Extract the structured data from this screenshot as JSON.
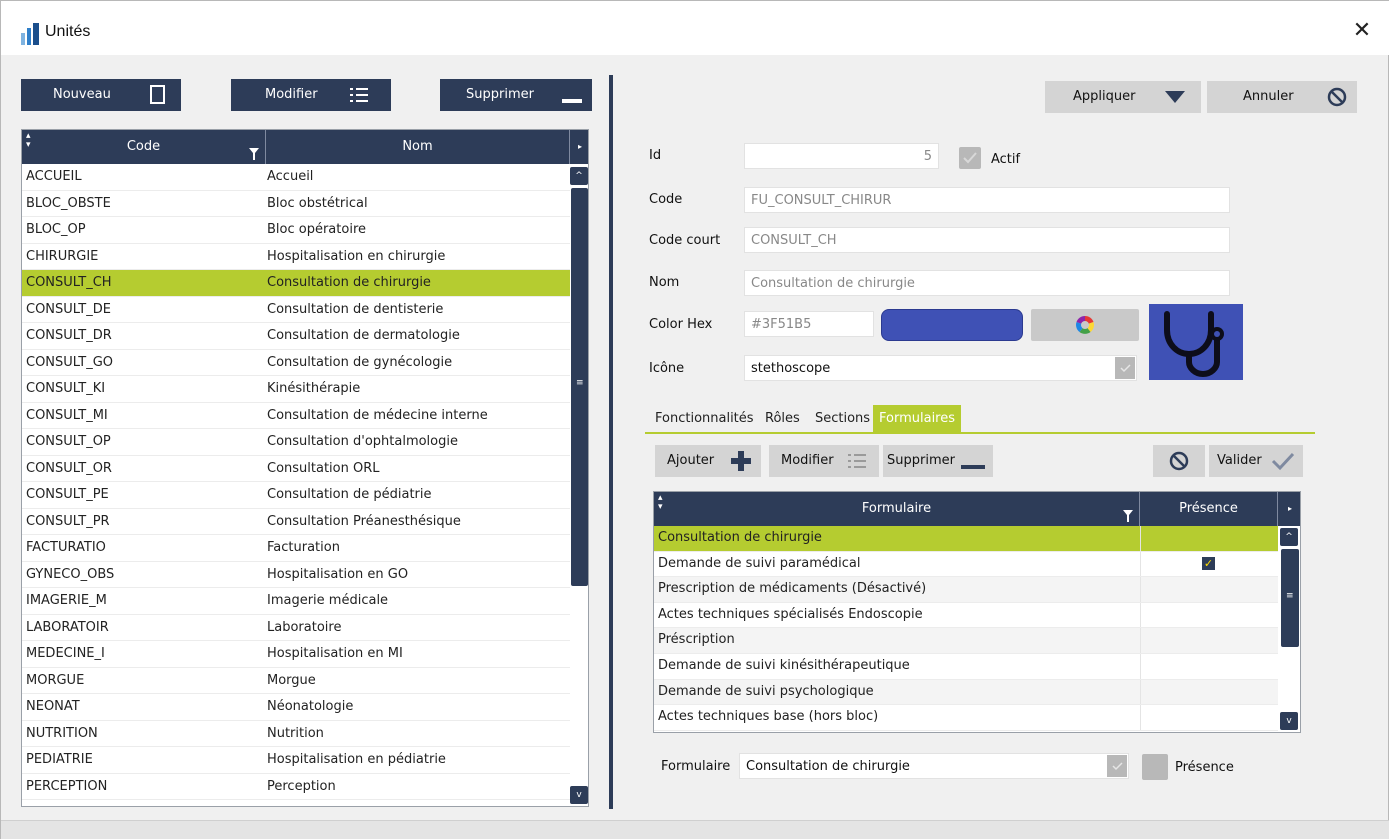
{
  "window": {
    "title": "Unités",
    "close_glyph": "✕"
  },
  "left_toolbar": {
    "new_label": "Nouveau",
    "edit_label": "Modifier",
    "delete_label": "Supprimer"
  },
  "left_grid": {
    "columns": [
      "Code",
      "Nom"
    ],
    "selected_index": 4,
    "rows": [
      {
        "code": "ACCUEIL",
        "nom": "Accueil"
      },
      {
        "code": "BLOC_OBSTE",
        "nom": "Bloc obstétrical"
      },
      {
        "code": "BLOC_OP",
        "nom": "Bloc opératoire"
      },
      {
        "code": "CHIRURGIE",
        "nom": "Hospitalisation en chirurgie"
      },
      {
        "code": "CONSULT_CH",
        "nom": "Consultation de chirurgie"
      },
      {
        "code": "CONSULT_DE",
        "nom": "Consultation de dentisterie"
      },
      {
        "code": "CONSULT_DR",
        "nom": "Consultation de dermatologie"
      },
      {
        "code": "CONSULT_GO",
        "nom": "Consultation de gynécologie"
      },
      {
        "code": "CONSULT_KI",
        "nom": "Kinésithérapie"
      },
      {
        "code": "CONSULT_MI",
        "nom": "Consultation de médecine interne"
      },
      {
        "code": "CONSULT_OP",
        "nom": "Consultation d'ophtalmologie"
      },
      {
        "code": "CONSULT_OR",
        "nom": "Consultation ORL"
      },
      {
        "code": "CONSULT_PE",
        "nom": "Consultation de pédiatrie"
      },
      {
        "code": "CONSULT_PR",
        "nom": "Consultation Préanesthésique"
      },
      {
        "code": "FACTURATIO",
        "nom": "Facturation"
      },
      {
        "code": "GYNECO_OBS",
        "nom": "Hospitalisation en GO"
      },
      {
        "code": "IMAGERIE_M",
        "nom": "Imagerie médicale"
      },
      {
        "code": "LABORATOIR",
        "nom": "Laboratoire"
      },
      {
        "code": "MEDECINE_I",
        "nom": "Hospitalisation en MI"
      },
      {
        "code": "MORGUE",
        "nom": "Morgue"
      },
      {
        "code": "NEONAT",
        "nom": "Néonatologie"
      },
      {
        "code": "NUTRITION",
        "nom": "Nutrition"
      },
      {
        "code": "PEDIATRIE",
        "nom": "Hospitalisation en pédiatrie"
      },
      {
        "code": "PERCEPTION",
        "nom": "Perception"
      }
    ]
  },
  "right_toolbar": {
    "apply_label": "Appliquer",
    "cancel_label": "Annuler"
  },
  "form": {
    "id_label": "Id",
    "id_value": "5",
    "active_label": "Actif",
    "code_label": "Code",
    "code_value": "FU_CONSULT_CHIRUR",
    "short_code_label": "Code court",
    "short_code_value": "CONSULT_CH",
    "name_label": "Nom",
    "name_value": "Consultation de chirurgie",
    "color_label": "Color Hex",
    "color_value": "#3F51B5",
    "icon_label": "Icône",
    "icon_value": "stethoscope"
  },
  "colors": {
    "accent": "#b5cc30",
    "navy": "#2d3c58",
    "unit_color": "#3f51b5"
  },
  "tabs": [
    {
      "label": "Fonctionnalités",
      "active": false
    },
    {
      "label": "Rôles",
      "active": false
    },
    {
      "label": "Sections",
      "active": false
    },
    {
      "label": "Formulaires",
      "active": true
    }
  ],
  "sub_toolbar": {
    "add_label": "Ajouter",
    "edit_label": "Modifier",
    "delete_label": "Supprimer",
    "validate_label": "Valider"
  },
  "forms_grid": {
    "columns": [
      "Formulaire",
      "Présence"
    ],
    "selected_index": 0,
    "rows": [
      {
        "name": "Consultation de chirurgie",
        "presence": false
      },
      {
        "name": "Demande de suivi paramédical",
        "presence": true
      },
      {
        "name": "Prescription de médicaments (Désactivé)",
        "presence": false
      },
      {
        "name": "Actes techniques spécialisés Endoscopie",
        "presence": false
      },
      {
        "name": "Préscription",
        "presence": false
      },
      {
        "name": "Demande de suivi kinésithérapeutique",
        "presence": false
      },
      {
        "name": "Demande de suivi psychologique",
        "presence": false
      },
      {
        "name": "Actes techniques base (hors bloc)",
        "presence": false
      }
    ]
  },
  "bottom_form": {
    "form_label": "Formulaire",
    "form_value": "Consultation de chirurgie",
    "presence_label": "Présence"
  }
}
